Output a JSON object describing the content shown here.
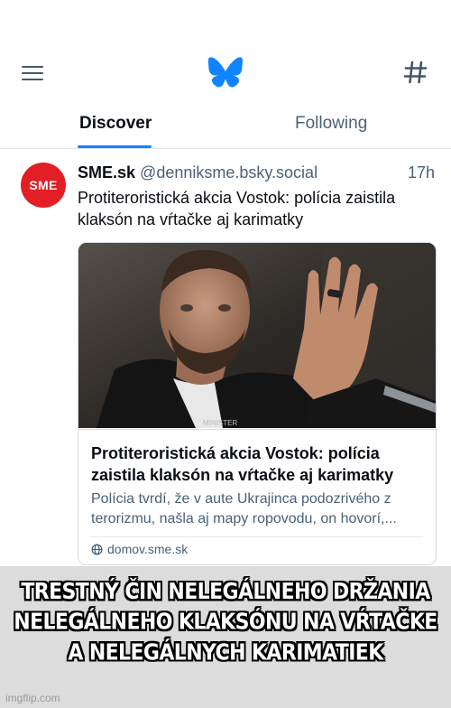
{
  "app": {
    "logo": "butterfly-logo",
    "brand_color": "#1083fe"
  },
  "header": {
    "menu_icon": "hamburger-menu-icon",
    "feeds_icon": "hash-icon"
  },
  "tabs": [
    {
      "label": "Discover",
      "active": true
    },
    {
      "label": "Following",
      "active": false
    }
  ],
  "post": {
    "avatar_text": "SME",
    "avatar_color": "#e41e26",
    "author_name": "SME.sk",
    "author_handle": "@denniksme.bsky.social",
    "time": "17h",
    "text": "Protiteroristická akcia Vostok: polícia zaistila klaksón na vŕtačke aj karimatky",
    "card": {
      "title": "Protiteroristická akcia Vostok: polícia zaistila klaksón na vŕtačke aj karimatky",
      "description": "Polícia tvrdí, že v aute Ukrajinca podozrivého z terorizmu, našla aj mapy ropovodu, on hovorí,...",
      "domain": "domov.sme.sk",
      "image_badge": "MINISTER"
    }
  },
  "meme": {
    "caption": "TRESTNÝ ČIN NELEGÁLNEHO DRŽANIA NELEGÁLNEHO KLAKSÓNU NA VŔTAČKE A NELEGÁLNYCH KARIMATIEK",
    "watermark": "imgflip.com"
  }
}
